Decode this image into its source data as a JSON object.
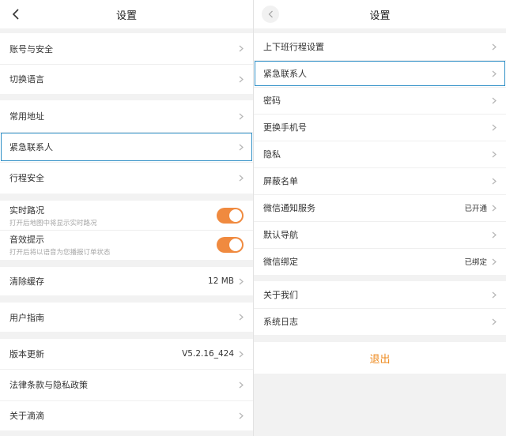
{
  "left": {
    "header": {
      "title": "设置"
    },
    "groups": [
      {
        "items": [
          {
            "label": "账号与安全"
          },
          {
            "label": "切换语言"
          }
        ]
      },
      {
        "items": [
          {
            "label": "常用地址"
          },
          {
            "label": "紧急联系人"
          },
          {
            "label": "行程安全"
          }
        ]
      },
      {
        "toggles": [
          {
            "label": "实时路况",
            "sub": "打开后地图中将显示实时路况",
            "on": true
          },
          {
            "label": "音效提示",
            "sub": "打开后将以语音为您播报订单状态",
            "on": true
          }
        ]
      },
      {
        "items": [
          {
            "label": "清除缓存",
            "value": "12 MB"
          }
        ]
      },
      {
        "items": [
          {
            "label": "用户指南"
          }
        ]
      },
      {
        "items": [
          {
            "label": "版本更新",
            "value": "V5.2.16_424"
          },
          {
            "label": "法律条款与隐私政策"
          },
          {
            "label": "关于滴滴"
          }
        ]
      }
    ]
  },
  "right": {
    "header": {
      "title": "设置"
    },
    "groups": [
      {
        "items": [
          {
            "label": "上下班行程设置"
          },
          {
            "label": "紧急联系人"
          },
          {
            "label": "密码"
          },
          {
            "label": "更换手机号"
          },
          {
            "label": "隐私"
          },
          {
            "label": "屏蔽名单"
          },
          {
            "label": "微信通知服务",
            "value": "已开通"
          },
          {
            "label": "默认导航"
          },
          {
            "label": "微信绑定",
            "value": "已绑定"
          }
        ]
      },
      {
        "items": [
          {
            "label": "关于我们"
          },
          {
            "label": "系统日志"
          }
        ]
      }
    ],
    "logout_label": "退出"
  },
  "colors": {
    "accent": "#f08a3f",
    "highlight": "#2f8fc6",
    "logout": "#ee8a1e"
  },
  "icons": {
    "back": "chevron-left-icon",
    "row": "chevron-right-icon"
  }
}
